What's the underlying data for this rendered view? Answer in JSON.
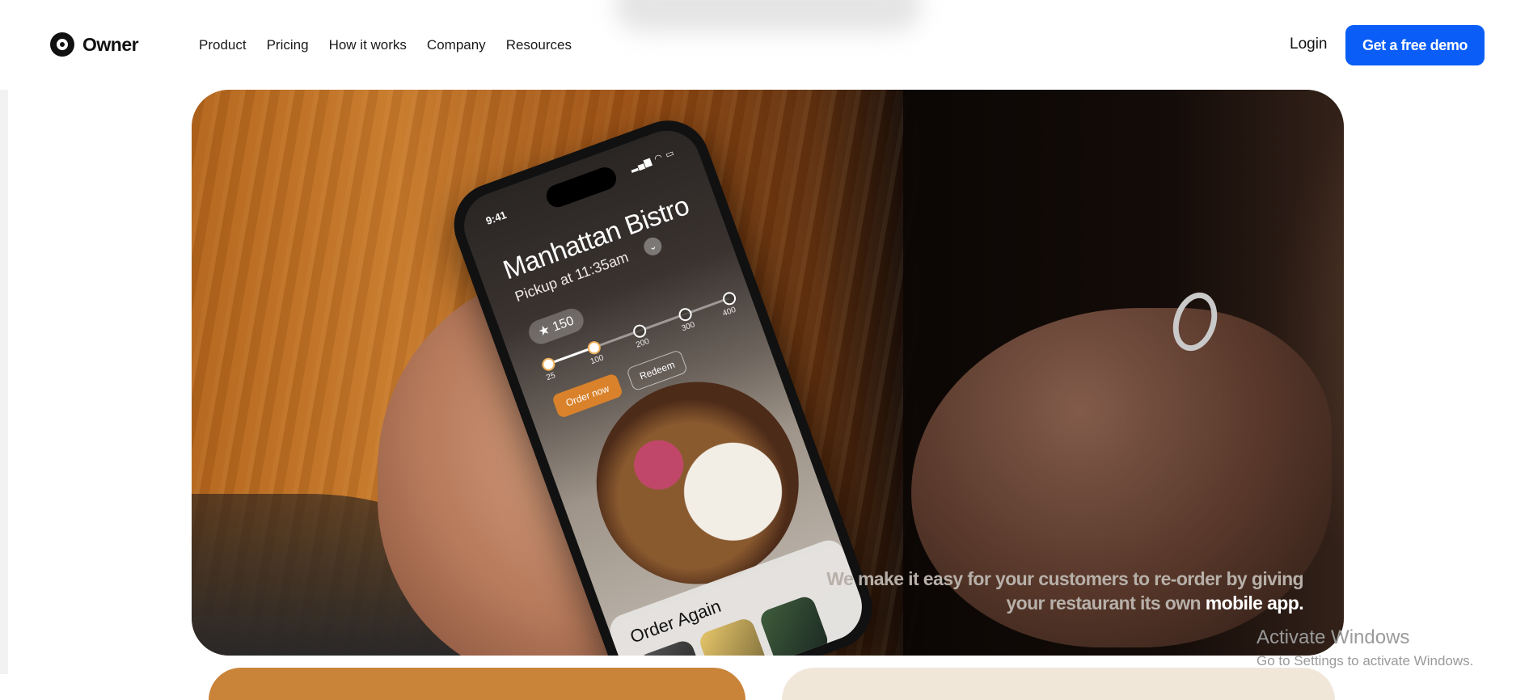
{
  "header": {
    "brand": "Owner",
    "nav": [
      "Product",
      "Pricing",
      "How it works",
      "Company",
      "Resources"
    ],
    "login_label": "Login",
    "cta_label": "Get a free demo"
  },
  "hero": {
    "phone": {
      "time": "9:41",
      "restaurant_name": "Manhattan Bistro",
      "pickup_text": "Pickup at 11:35am",
      "points_badge": "150",
      "tiers": [
        "25",
        "100",
        "200",
        "300",
        "400"
      ],
      "order_now_label": "Order now",
      "redeem_label": "Redeem",
      "order_again_title": "Order Again"
    },
    "caption_part1": "We make it easy for your customers to re-order by giving your restaurant its own",
    "caption_strong": "mobile app."
  },
  "watermark": {
    "title": "Activate Windows",
    "subtitle": "Go to Settings to activate Windows."
  },
  "colors": {
    "accent": "#0a5ef7",
    "orange_button": "#d9822b"
  }
}
